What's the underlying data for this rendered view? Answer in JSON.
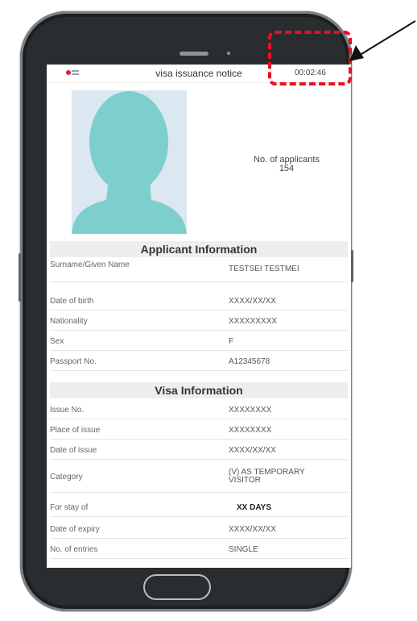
{
  "header": {
    "title": "visa issuance notice",
    "timer": "00:02:46"
  },
  "applicants": {
    "label": "No. of applicants",
    "count": "154"
  },
  "applicant_info": {
    "title": "Applicant Information",
    "rows": [
      {
        "label": "Surname/Given Name",
        "value": "TESTSEI TESTMEI"
      },
      {
        "label": "Date of birth",
        "value": "XXXX/XX/XX"
      },
      {
        "label": "Nationality",
        "value": "XXXXXXXXX"
      },
      {
        "label": "Sex",
        "value": "F"
      },
      {
        "label": "Passport No.",
        "value": "A12345678"
      }
    ]
  },
  "visa_info": {
    "title": "Visa Information",
    "rows": [
      {
        "label": "Issue No.",
        "value": "XXXXXXXX"
      },
      {
        "label": "Place of issue",
        "value": "XXXXXXXX"
      },
      {
        "label": "Date of issue",
        "value": "XXXX/XX/XX"
      },
      {
        "label": "Category",
        "value": "(V) AS TEMPORARY VISITOR"
      },
      {
        "label": "For stay of",
        "value": "XX DAYS"
      },
      {
        "label": "Date of expiry",
        "value": "XXXX/XX/XX"
      },
      {
        "label": "No. of entries",
        "value": "SINGLE"
      }
    ]
  },
  "colors": {
    "annotation": "#e8101f",
    "photo_silhouette": "#7ccfcd",
    "photo_background": "#dbe7f1"
  },
  "icons": [
    "logo-icon",
    "home-button",
    "arrow-icon"
  ]
}
